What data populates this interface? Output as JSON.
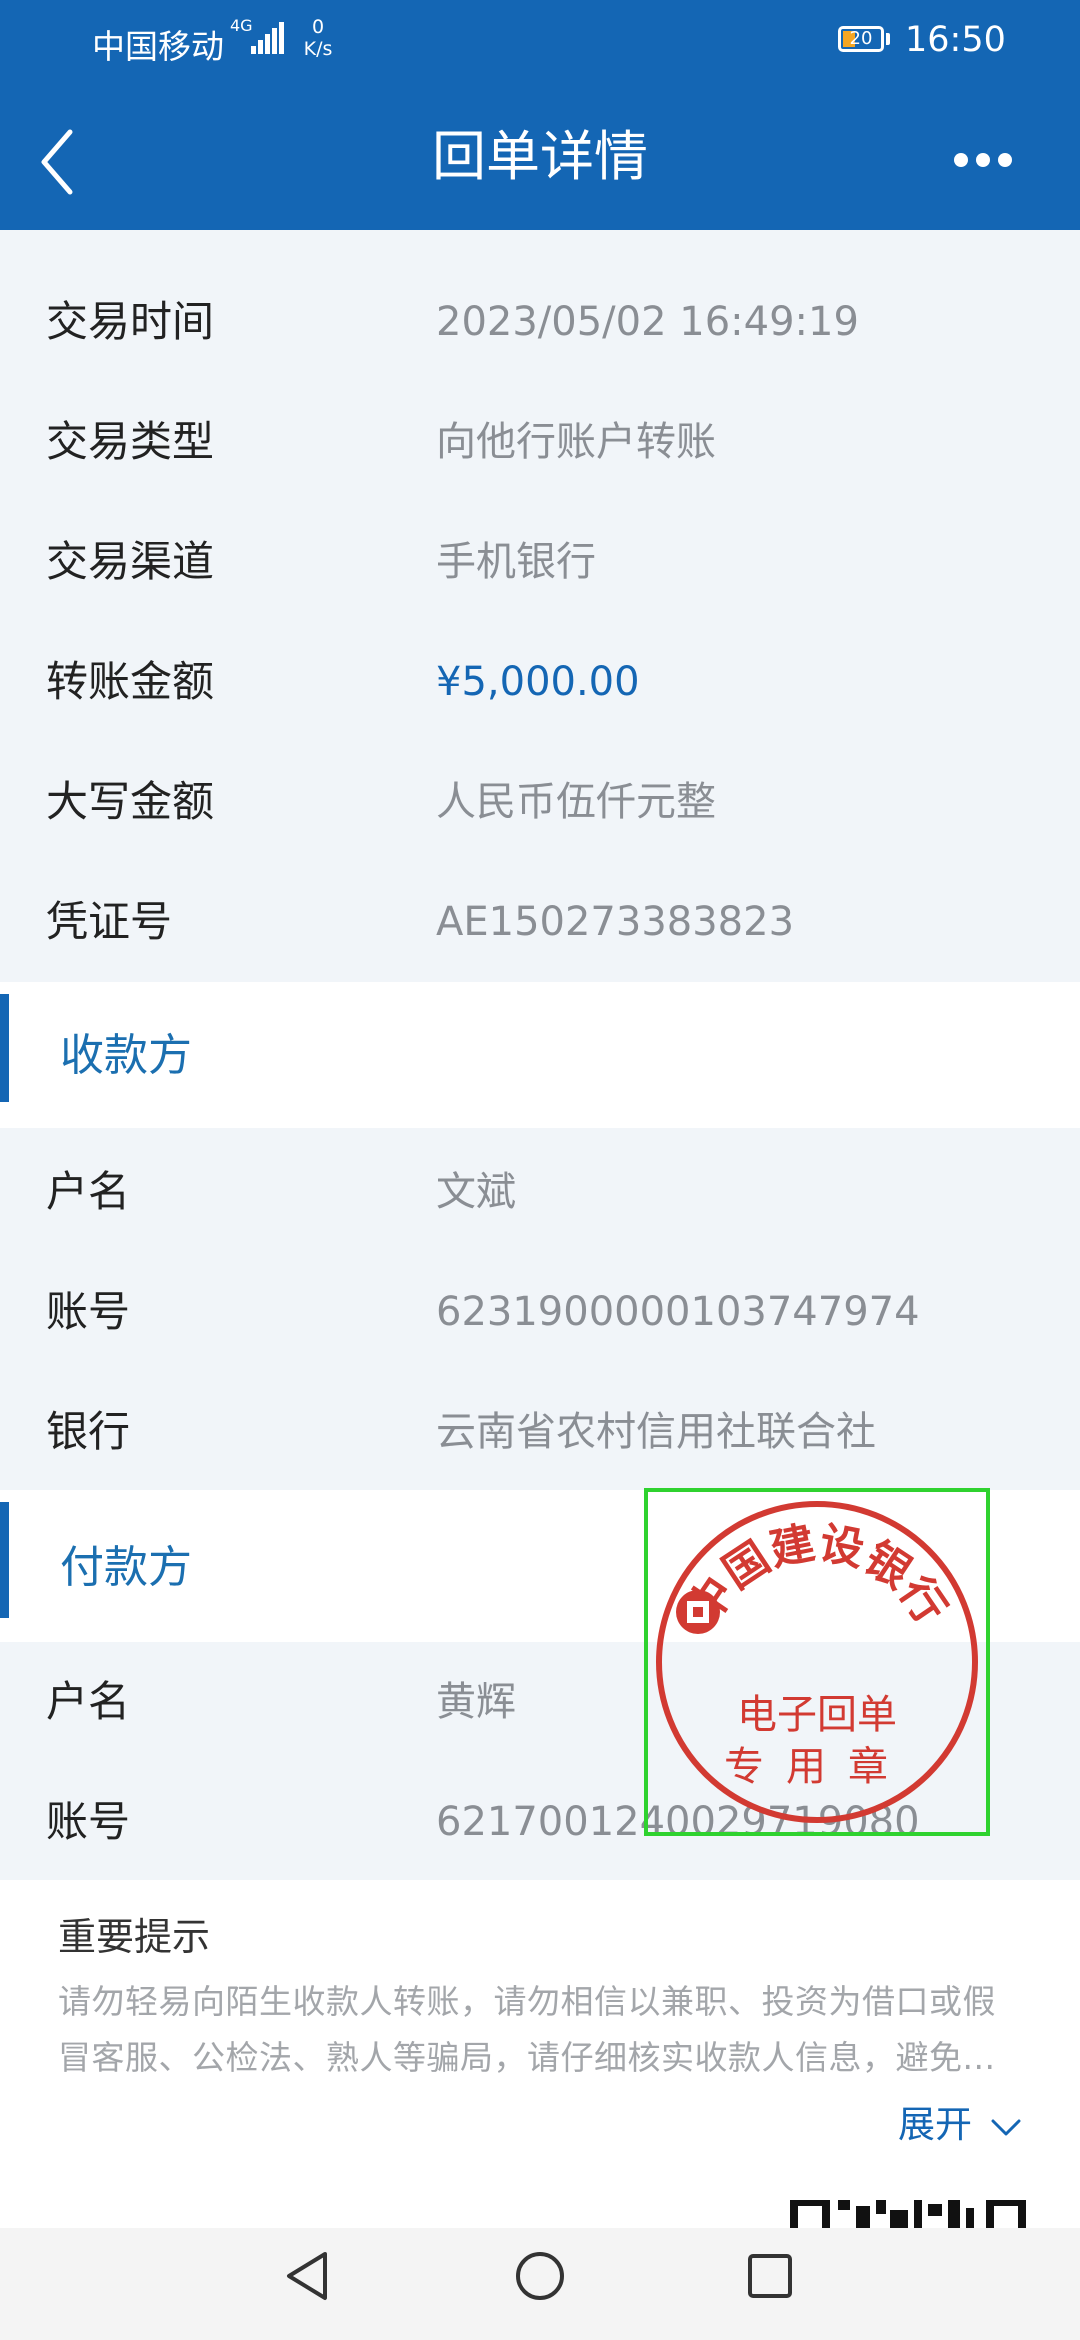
{
  "status_bar": {
    "carrier": "中国移动",
    "network": "4G",
    "speed_value": "0",
    "speed_unit": "K/s",
    "battery": "20",
    "time": "16:50"
  },
  "header": {
    "title": "回单详情"
  },
  "transaction": [
    {
      "label": "交易时间",
      "value": "2023/05/02 16:49:19"
    },
    {
      "label": "交易类型",
      "value": "向他行账户转账"
    },
    {
      "label": "交易渠道",
      "value": "手机银行"
    },
    {
      "label": "转账金额",
      "value": "¥5,000.00"
    },
    {
      "label": "大写金额",
      "value": "人民币伍仟元整"
    },
    {
      "label": "凭证号",
      "value": "AE150273383823"
    }
  ],
  "payee": {
    "section_title": "收款方",
    "fields": [
      {
        "label": "户名",
        "value": "文斌"
      },
      {
        "label": "账号",
        "value": "6231900000103747974"
      },
      {
        "label": "银行",
        "value": "云南省农村信用社联合社"
      }
    ]
  },
  "payer": {
    "section_title": "付款方",
    "fields": [
      {
        "label": "户名",
        "value": "黄辉"
      },
      {
        "label": "账号",
        "value": "6217001240029719080"
      }
    ]
  },
  "stamp": {
    "bank_name": "中国建设银行",
    "line1": "电子回单",
    "line2": "专用章",
    "color": "#d23a32"
  },
  "notice": {
    "title": "重要提示",
    "text": "请勿轻易向陌生收款人转账，请勿相信以兼职、投资为借口或假冒客服、公检法、熟人等骗局，请仔细核实收款人信息，避免...",
    "expand_label": "展开"
  },
  "colors": {
    "primary": "#1466b4",
    "highlight_box": "#2fd22f"
  },
  "icons": {
    "back": "chevron-left-icon",
    "more": "more-dots-icon",
    "expand": "chevron-down-icon",
    "nav_back": "triangle-back-icon",
    "nav_home": "circle-home-icon",
    "nav_recent": "square-recent-icon"
  }
}
